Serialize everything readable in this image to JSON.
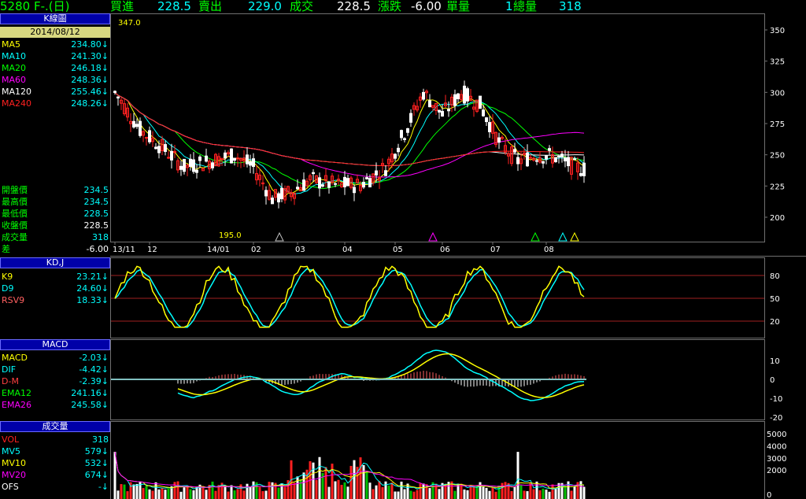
{
  "header": {
    "title": "5280 F-.(日)",
    "buy_label": "買進",
    "buy_value": "228.5",
    "sell_label": "賣出",
    "sell_value": "229.0",
    "deal_label": "成交",
    "deal_value": "228.5",
    "change_label": "漲跌",
    "change_value": "-6.00",
    "unit_vol_label": "單量",
    "unit_vol_value": "1",
    "total_vol_label": "總量",
    "total_vol_value": "318"
  },
  "kline": {
    "panel_title": "K線圖",
    "date": "2014/08/12",
    "ma": [
      {
        "label": "MA5",
        "value": "234.80",
        "arrow": "↓",
        "color": "#ffff00"
      },
      {
        "label": "MA10",
        "value": "241.30",
        "arrow": "↓",
        "color": "#00ffff"
      },
      {
        "label": "MA20",
        "value": "246.18",
        "arrow": "↓",
        "color": "#00ff00"
      },
      {
        "label": "MA60",
        "value": "248.36",
        "arrow": "↓",
        "color": "#ff00ff"
      },
      {
        "label": "MA120",
        "value": "255.46",
        "arrow": "↓",
        "color": "#ffffff"
      },
      {
        "label": "MA240",
        "value": "248.26",
        "arrow": "↓",
        "color": "#ff2020"
      }
    ],
    "prices": [
      {
        "label": "開盤價",
        "value": "234.5"
      },
      {
        "label": "最高價",
        "value": "234.5"
      },
      {
        "label": "最低價",
        "value": "228.5"
      },
      {
        "label": "收盤價",
        "value": "228.5"
      },
      {
        "label": "成交量",
        "value": "318"
      },
      {
        "label": "差",
        "value": "-6.00"
      }
    ],
    "high_mark": "347.0",
    "low_mark": "195.0",
    "y_ticks": [
      "350",
      "325",
      "300",
      "275",
      "250",
      "225",
      "200"
    ],
    "x_ticks": [
      "13/11",
      "12",
      "14/01",
      "02",
      "03",
      "04",
      "05",
      "06",
      "07",
      "08"
    ]
  },
  "kd": {
    "panel_title": "KD,J",
    "rows": [
      {
        "label": "K9",
        "value": "23.21",
        "arrow": "↓",
        "color": "#ffff00"
      },
      {
        "label": "D9",
        "value": "24.60",
        "arrow": "↓",
        "color": "#00ffff"
      },
      {
        "label": "RSV9",
        "value": "18.33",
        "arrow": "↓",
        "color": "#ff6060"
      }
    ],
    "y_ticks": [
      "80",
      "50",
      "20"
    ]
  },
  "macd": {
    "panel_title": "MACD",
    "rows": [
      {
        "label": "MACD",
        "value": "-2.03",
        "arrow": "↓",
        "color": "#ffff00"
      },
      {
        "label": "DIF",
        "value": "-4.42",
        "arrow": "↓",
        "color": "#00ffff"
      },
      {
        "label": "D-M",
        "value": "-2.39",
        "arrow": "↓",
        "color": "#ff4040"
      },
      {
        "label": "EMA12",
        "value": "241.16",
        "arrow": "↓",
        "color": "#00ff00"
      },
      {
        "label": "EMA26",
        "value": "245.58",
        "arrow": "↓",
        "color": "#ff00ff"
      }
    ],
    "y_ticks": [
      "10",
      "0",
      "-10",
      "-20"
    ]
  },
  "volume": {
    "panel_title": "成交量",
    "rows": [
      {
        "label": "VOL",
        "value": "318",
        "arrow": "",
        "color": "#ff2020"
      },
      {
        "label": "MV5",
        "value": "579",
        "arrow": "↓",
        "color": "#00ffff"
      },
      {
        "label": "MV10",
        "value": "532",
        "arrow": "↓",
        "color": "#ffff00"
      },
      {
        "label": "MV20",
        "value": "674",
        "arrow": "↓",
        "color": "#ff00ff"
      },
      {
        "label": "OFS",
        "value": "-",
        "arrow": "↓",
        "color": "#ffffff"
      }
    ],
    "y_ticks": [
      "5000",
      "4000",
      "3000",
      "2000",
      "0"
    ]
  },
  "colors": {
    "up": "#ff2020",
    "down": "#ffffff",
    "label": "#00ff00",
    "title_bg": "#0000a8"
  }
}
